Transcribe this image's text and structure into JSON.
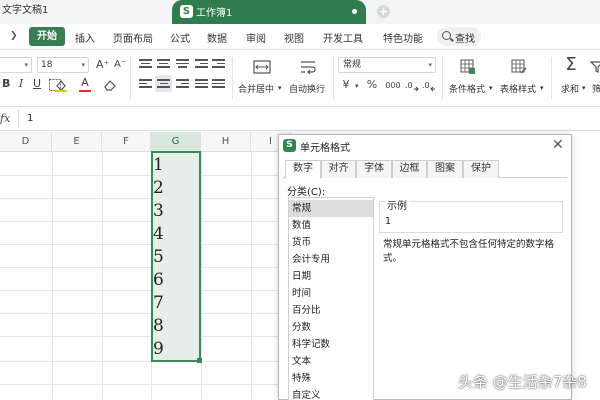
{
  "tabs": {
    "doc": "文字文稿1",
    "workbook": "工作簿1",
    "logo_letter": "S"
  },
  "menu": {
    "items": [
      "开始",
      "插入",
      "页面布局",
      "公式",
      "数据",
      "审阅",
      "视图",
      "开发工具",
      "特色功能"
    ],
    "active_index": 0,
    "search": "查找"
  },
  "toolbar": {
    "font_name": "",
    "font_size": "18",
    "bold": "B",
    "italic": "I",
    "underline": "U",
    "grow_font": "A⁺",
    "shrink_font": "A⁻",
    "font_color_letter": "A",
    "merge_center": "合并居中",
    "wrap_text": "自动换行",
    "number_format": "常规",
    "currency": "¥",
    "percent": "%",
    "thousands": "000",
    "conditional_format": "条件格式",
    "table_style": "表格样式",
    "sum_symbol": "Σ",
    "sum": "求和",
    "filter": "筛"
  },
  "formula_bar": {
    "fx": "fx",
    "value": "1"
  },
  "grid": {
    "columns": [
      "D",
      "E",
      "F",
      "G",
      "H",
      "I"
    ],
    "selected_column": "G",
    "values": [
      "1",
      "2",
      "3",
      "4",
      "5",
      "6",
      "7",
      "8",
      "9"
    ]
  },
  "dialog": {
    "title": "单元格格式",
    "tabs": [
      "数字",
      "对齐",
      "字体",
      "边框",
      "图案",
      "保护"
    ],
    "active_tab": 0,
    "category_label": "分类(C):",
    "categories": [
      "常规",
      "数值",
      "货币",
      "会计专用",
      "日期",
      "时间",
      "百分比",
      "分数",
      "科学记数",
      "文本",
      "特殊",
      "自定义"
    ],
    "selected_category": 0,
    "sample_label": "示例",
    "sample_value": "1",
    "description": "常规单元格格式不包含任何特定的数字格式。"
  },
  "watermark": "头条 @生活杂7杂8",
  "colors": {
    "accent_green": "#2f7d4d",
    "selection_border": "#3c8a5a",
    "selection_fill": "#e8efe9"
  }
}
